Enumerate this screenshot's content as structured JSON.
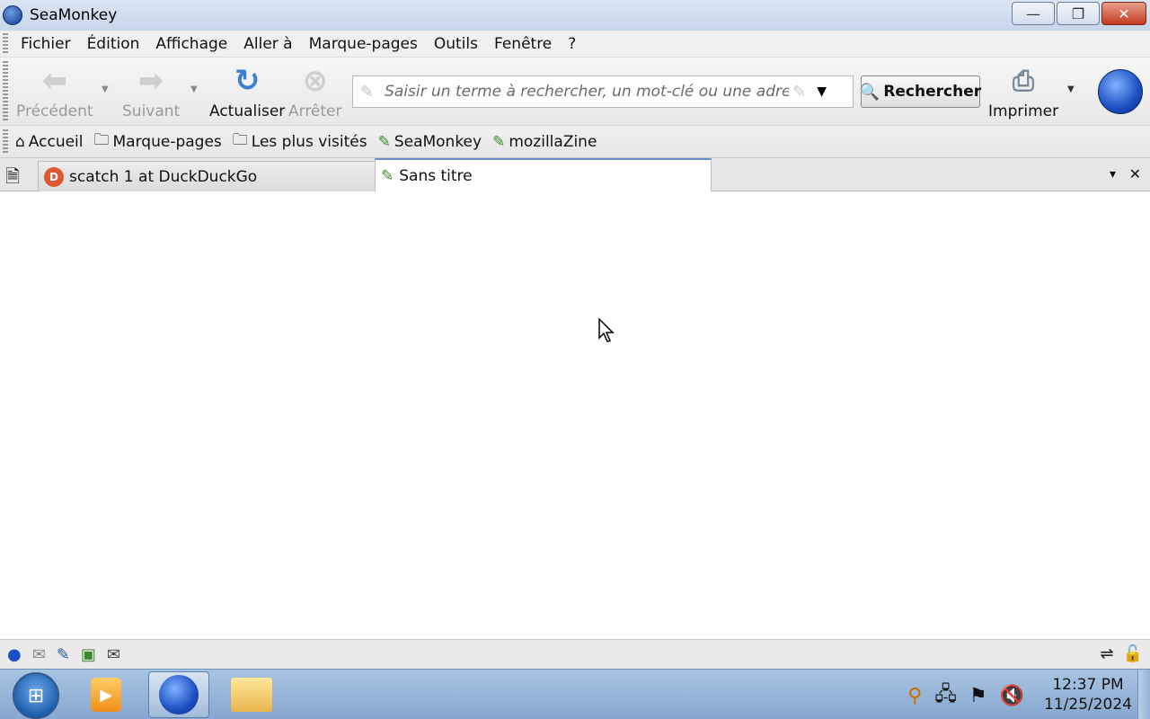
{
  "window": {
    "title": "SeaMonkey",
    "minimize": "—",
    "restore": "❐",
    "close": "✕"
  },
  "menubar": {
    "items": [
      "Fichier",
      "Édition",
      "Affichage",
      "Aller à",
      "Marque-pages",
      "Outils",
      "Fenêtre",
      "?"
    ]
  },
  "navbar": {
    "back_label": "Précédent",
    "forward_label": "Suivant",
    "reload_label": "Actualiser",
    "stop_label": "Arrêter",
    "url_placeholder": "Saisir un terme à rechercher, un mot-clé ou une adresse web",
    "url_value": "",
    "search_label": "Rechercher",
    "print_label": "Imprimer"
  },
  "bookmarks": {
    "items": [
      {
        "label": "Accueil",
        "icon": "home-icon"
      },
      {
        "label": "Marque-pages",
        "icon": "folder-icon"
      },
      {
        "label": "Les plus visités",
        "icon": "folder-recent-icon"
      },
      {
        "label": "SeaMonkey",
        "icon": "seamonkey-leaf-icon"
      },
      {
        "label": "mozillaZine",
        "icon": "seamonkey-leaf-icon"
      }
    ]
  },
  "tabs": [
    {
      "label": "scatch 1 at DuckDuckGo",
      "active": false,
      "icon": "duckduckgo-icon"
    },
    {
      "label": "Sans titre",
      "active": true,
      "icon": "seamonkey-leaf-icon"
    }
  ],
  "taskbar": {
    "time": "12:37 PM",
    "date": "11/25/2024"
  }
}
